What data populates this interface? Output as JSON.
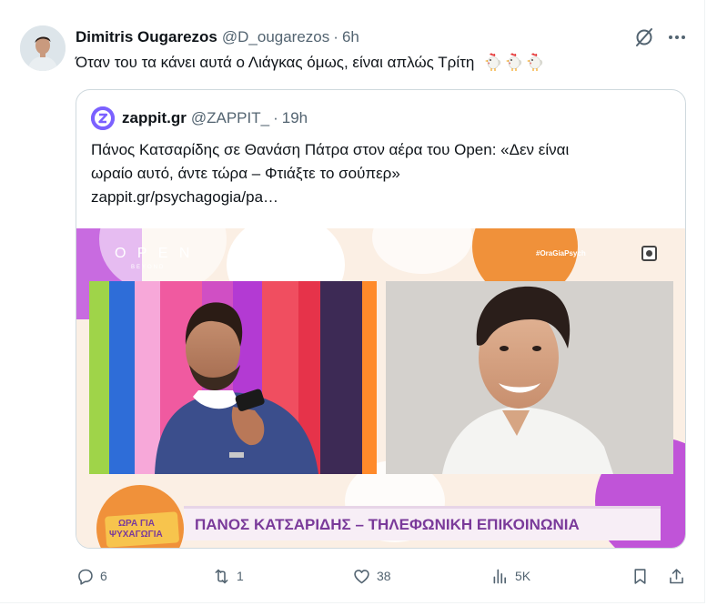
{
  "tweet": {
    "author_name": "Dimitris Ougarezos",
    "author_handle": "@D_ougarezos",
    "separator": "·",
    "time": "6h",
    "text": "Όταν του τα κάνει αυτά ο Λιάγκας όμως, είναι απλώς Τρίτη",
    "emojis": [
      "rooster-emoji",
      "rooster-emoji",
      "rooster-emoji"
    ]
  },
  "quote": {
    "author_name": "zappit.gr",
    "author_handle": "@ZAPPIT_",
    "separator": "·",
    "time": "19h",
    "text_line1": "Πάνος Κατσαρίδης σε Θανάση Πάτρα στον αέρα του Open: «Δεν είναι",
    "text_line2": "ωραίο αυτό, άντε τώρα – Φτιάξτε το σούπερ»",
    "link": "zappit.gr/psychagogia/pa…",
    "media": {
      "hashtag": "#OraGiaPsych",
      "channel_logo": "O P E N",
      "channel_sub": "BEYOND",
      "show_logo_line1": "ΩΡΑ ΓΙΑ",
      "show_logo_line2": "ΨΥΧΑΓΩΓΙΑ",
      "lower_third": "ΠΑΝΟΣ ΚΑΤΣΑΡΙΔΗΣ – ΤΗΛΕΦΩΝΙΚΗ ΕΠΙΚΟΙΝΩΝΙΑ"
    }
  },
  "actions": {
    "replies": "6",
    "reposts": "1",
    "likes": "38",
    "views": "5K"
  },
  "colors": {
    "text_primary": "#0f1419",
    "text_secondary": "#536471",
    "border": "#cfd9de",
    "zappit_purple": "#7b61ff",
    "studio_orange": "#f0913a",
    "studio_purple": "#c054d8"
  }
}
